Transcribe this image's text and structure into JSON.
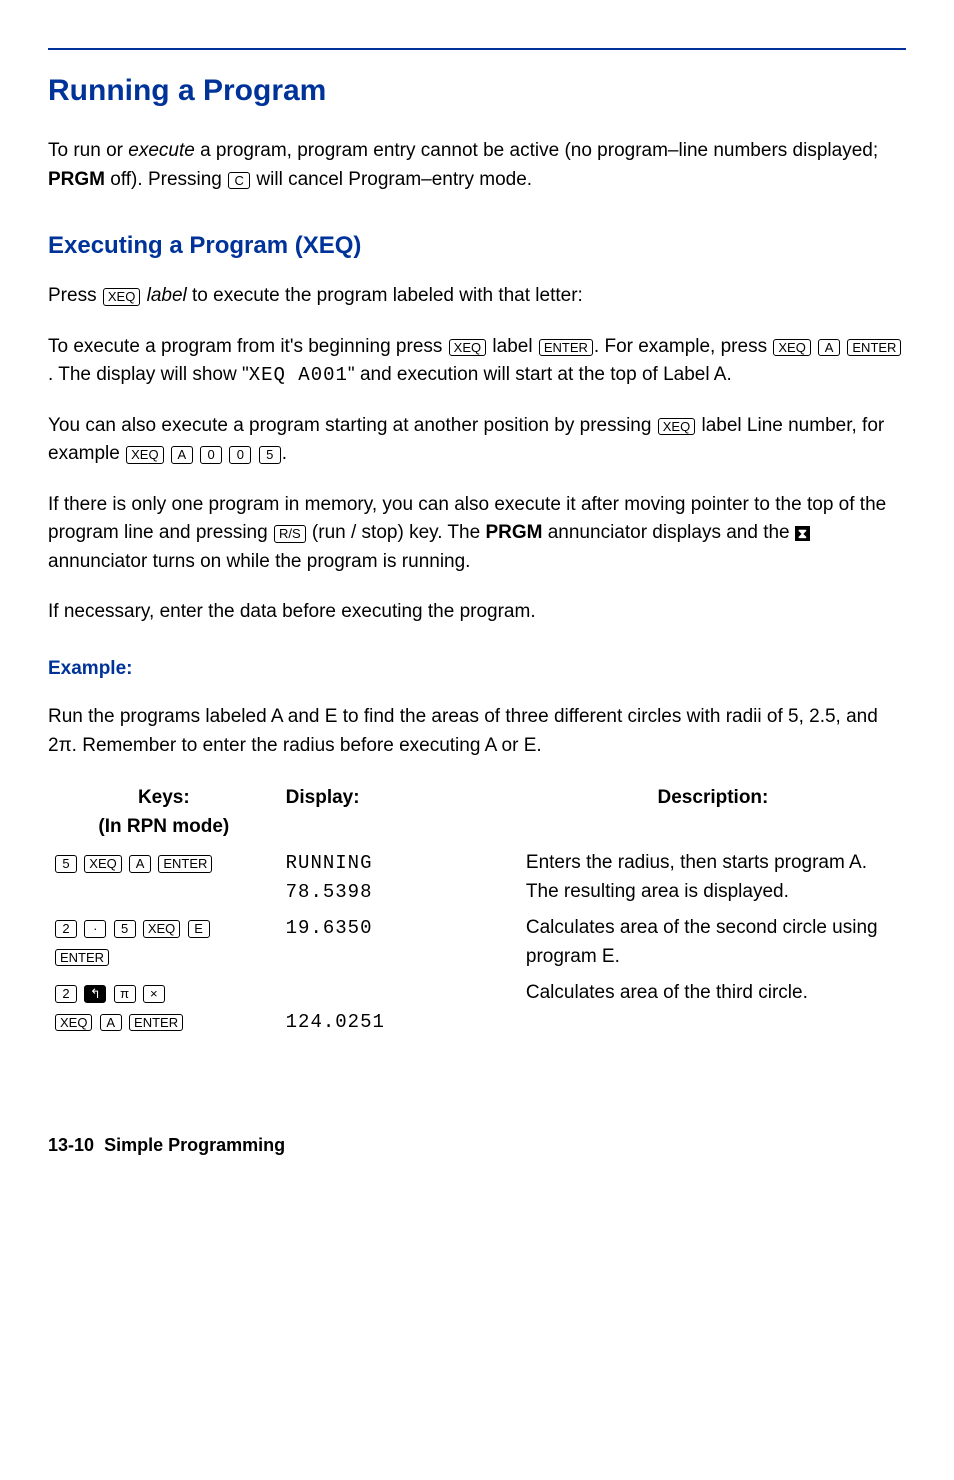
{
  "heading1": "Running a Program",
  "intro_part1": "To run or ",
  "intro_execute": "execute",
  "intro_part2": " a program, program entry cannot be active (no program–line numbers displayed; ",
  "intro_prgm": "PRGM",
  "intro_part3": " off). Pressing ",
  "intro_part4": " will cancel Program–entry mode.",
  "heading2": "Executing a Program (XEQ)",
  "p2_a": "Press ",
  "p2_label": " label",
  "p2_b": " to execute the program labeled with that letter:",
  "p3_a": "To execute a program from it's beginning press ",
  "p3_b": " label ",
  "p3_c": ". For example, press ",
  "p3_d": ". The display will show \"",
  "p3_lcd": "XEQ A001",
  "p3_e": "\" and execution will start at the top of Label A.",
  "p4_a": "You can also execute a program starting at another position by pressing ",
  "p4_b": " label Line number, for example ",
  "p4_c": ".",
  "p5_a": "If there is only one program in memory, you can also execute it after moving pointer to the top of the program line and pressing ",
  "p5_b": " (run / stop) key. The ",
  "p5_prgm": "PRGM",
  "p5_c": " annunciator displays and the ",
  "p5_busy": "⧗",
  "p5_d": " annunciator turns on while the program is running.",
  "p6": "If necessary, enter the data before executing the program.",
  "example_label": "Example:",
  "p7": "Run the programs labeled A and E to find the areas of three different circles with radii of 5, 2.5, and 2π. Remember to enter the radius before executing A or E.",
  "table": {
    "headers": {
      "keys_l1": "Keys:",
      "keys_l2": "(In RPN mode)",
      "display": "Display:",
      "desc": "Description:"
    },
    "rows": [
      {
        "keys": [
          "5",
          "XEQ",
          "A",
          "ENTER"
        ],
        "display_l1": "RUNNING",
        "display_l2": "78.5398",
        "desc": "Enters the radius, then starts program A. The resulting area is displayed."
      },
      {
        "keys_l1": [
          "2",
          "·",
          "5",
          "XEQ",
          "E"
        ],
        "keys_l2": [
          "ENTER"
        ],
        "display": "19.6350",
        "desc": "Calculates area of the second circle using program E."
      },
      {
        "keys_l1": [
          "2",
          "↰",
          "π",
          "×"
        ],
        "keys_l2": [
          "XEQ",
          "A",
          "ENTER"
        ],
        "display": "124.0251",
        "desc": "Calculates area of the third circle."
      }
    ]
  },
  "keycaps": {
    "C": "C",
    "XEQ": "XEQ",
    "ENTER": "ENTER",
    "A": "A",
    "E": "E",
    "zero": "0",
    "five": "5",
    "two": "2",
    "dot": "·",
    "RS": "R/S",
    "pi": "π",
    "times": "×",
    "shift": "↰"
  },
  "footer": {
    "page": "13-10",
    "title": "Simple Programming"
  }
}
